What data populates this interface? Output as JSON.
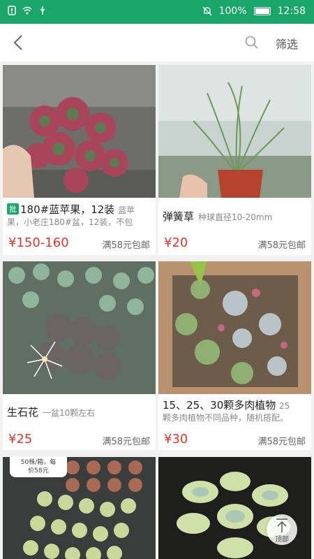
{
  "status_bar": {
    "battery": "100%",
    "time": "12:58"
  },
  "header": {
    "filter_label": "筛选"
  },
  "products": [
    {
      "badge": "批",
      "title": "180#蓝苹果，12装",
      "title_tail": "蓝苹",
      "desc": "果，小老庄180#盆，12装，不包",
      "price": "¥150-160",
      "shipping": "满58元包邮"
    },
    {
      "title": "弹簧草",
      "sub": "种球直径10-20mm",
      "price": "¥20",
      "shipping": "满58元包邮"
    },
    {
      "title": "生石花",
      "sub": "一盆10颗左右",
      "price": "¥25",
      "shipping": "满58元包邮"
    },
    {
      "title": "15、25、30颗多肉植物",
      "title_tail": "25",
      "desc": "颗多肉植物不同品种，随机搭配。",
      "price": "¥30",
      "shipping": "满58元包邮"
    },
    {
      "overlay_line1": "50株/箱，每",
      "overlay_line2": "价58元"
    },
    {}
  ],
  "back_to_top": {
    "label": "顶部"
  },
  "colors": {
    "accent": "#1aa56a",
    "price": "#e5352b"
  }
}
